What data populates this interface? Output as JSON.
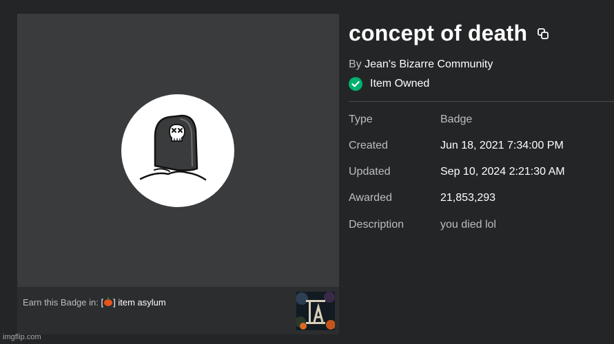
{
  "badge": {
    "title": "concept of death",
    "creator_prefix": "By",
    "creator_name": "Jean's Bizarre Community",
    "owned_label": "Item Owned"
  },
  "details": [
    {
      "label": "Type",
      "value": "Badge"
    },
    {
      "label": "Created",
      "value": "Jun 18, 2021 7:34:00 PM"
    },
    {
      "label": "Updated",
      "value": "Sep 10, 2024 2:21:30 AM"
    },
    {
      "label": "Awarded",
      "value": "21,853,293"
    },
    {
      "label": "Description",
      "value": "you died lol"
    }
  ],
  "earn": {
    "prefix": "Earn this Badge in:",
    "bracket_open": "[",
    "bracket_close": "]",
    "game_name": "item asylum"
  },
  "watermark": "imgflip.com",
  "icons": {
    "copy": "copy-icon",
    "owned": "check-circle-icon",
    "badge_image": "tombstone-skull-icon",
    "game_emoji": "pumpkin-icon"
  },
  "colors": {
    "background": "#232527",
    "panel": "#393b3d",
    "earn_bar": "#2b2d2f",
    "owned_green": "#00b06f",
    "muted_text": "#bdbebe"
  }
}
